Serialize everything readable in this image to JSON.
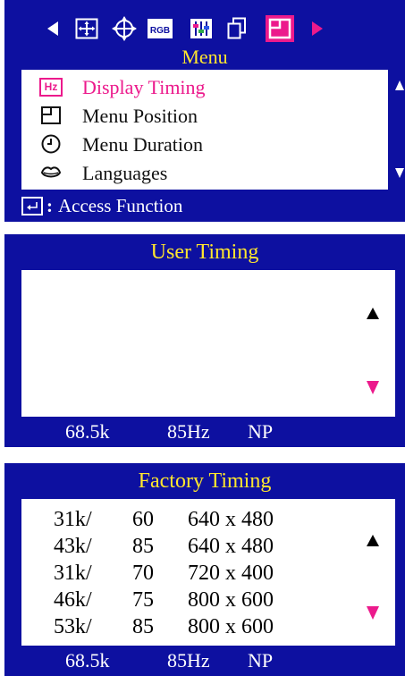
{
  "colors": {
    "panel_bg": "#0d10a0",
    "title_yellow": "#ffe62e",
    "highlight_pink": "#ec1a8c",
    "text_white": "#ffffff"
  },
  "menu_panel": {
    "icons": [
      {
        "name": "left-arrow-icon"
      },
      {
        "name": "position-move-icon"
      },
      {
        "name": "geometry-icon"
      },
      {
        "name": "rgb-color-icon"
      },
      {
        "name": "color-adjust-icon"
      },
      {
        "name": "copy-icon"
      },
      {
        "name": "menu-setup-icon",
        "selected": true
      },
      {
        "name": "right-arrow-icon"
      }
    ],
    "rgb_icon_text": "RGB",
    "title": "Menu",
    "items": [
      {
        "icon": "hz-icon",
        "icon_text": "Hz",
        "label": "Display Timing",
        "active": true
      },
      {
        "icon": "menu-position-icon",
        "label": "Menu Position"
      },
      {
        "icon": "clock-icon",
        "label": "Menu Duration"
      },
      {
        "icon": "lips-icon",
        "label": "Languages"
      }
    ],
    "footer": {
      "icon": "enter-icon",
      "separator": ":",
      "label": "Access Function"
    }
  },
  "user_timing_panel": {
    "title": "User Timing",
    "rows": [],
    "status": {
      "freq_h": "68.5k",
      "freq_v": "85Hz",
      "polarity": "NP"
    }
  },
  "factory_timing_panel": {
    "title": "Factory Timing",
    "rows": [
      {
        "h_freq": "31k/",
        "v_freq": "60",
        "resolution": "640 x 480"
      },
      {
        "h_freq": "43k/",
        "v_freq": "85",
        "resolution": "640 x 480"
      },
      {
        "h_freq": "31k/",
        "v_freq": "70",
        "resolution": "720 x 400"
      },
      {
        "h_freq": "46k/",
        "v_freq": "75",
        "resolution": "800 x 600"
      },
      {
        "h_freq": "53k/",
        "v_freq": "85",
        "resolution": "800 x 600"
      }
    ],
    "status": {
      "freq_h": "68.5k",
      "freq_v": "85Hz",
      "polarity": "NP"
    }
  }
}
